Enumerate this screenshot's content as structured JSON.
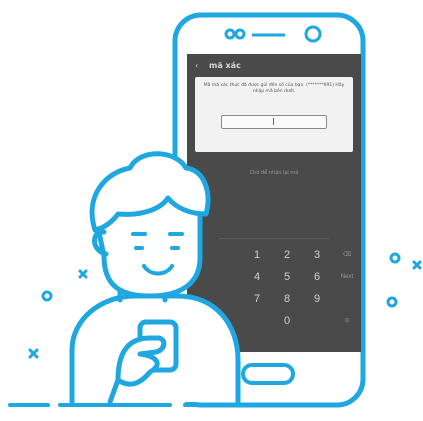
{
  "colors": {
    "outline": "#1ea7e1",
    "screen": "#4a4a4a",
    "dialog": "#f2f2f2"
  },
  "phone": {
    "appbar": {
      "back_icon": "arrow-left-icon",
      "title": "mã xác"
    },
    "dialog": {
      "message": "Mã mã xác thực đã được gửi đến số của bạn. (*******991) Hãy nhập mã bên dưới.",
      "input_value": ""
    },
    "resend_label": "Chờ để nhận lại mã",
    "keypad": {
      "keys": [
        "1",
        "2",
        "3",
        "⌫",
        "4",
        "5",
        "6",
        "Next",
        "7",
        "8",
        "9",
        "",
        "",
        "0",
        "",
        "⊙"
      ]
    }
  }
}
